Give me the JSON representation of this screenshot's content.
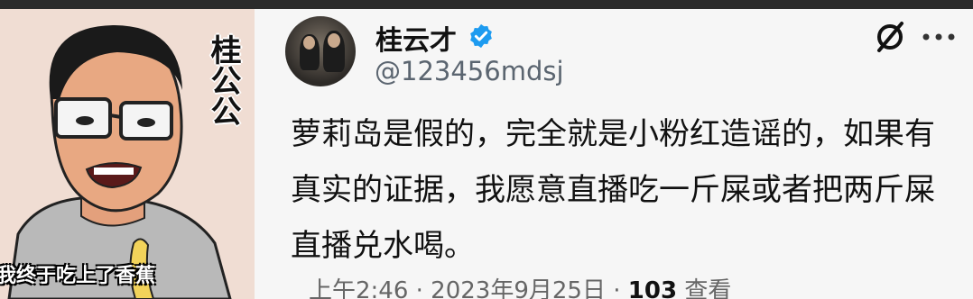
{
  "cartoon": {
    "title": "桂公公",
    "caption": "我终于吃上了香蕉"
  },
  "tweet": {
    "author_name": "桂云才",
    "handle": "@123456mdsj",
    "verified_icon": "verified-badge-icon",
    "text": "萝莉岛是假的，完全就是小粉红造谣的，如果有真实的证据，我愿意直播吃一斤屎或者把两斤屎直播兑水喝。",
    "timestamp": "上午2:46 · 2023年9月25日 · ",
    "views_count": "103",
    "views_label": " 查看"
  },
  "colors": {
    "verified": "#1d9bf0",
    "card_bg": "#f6f6f6",
    "cartoon_bg": "#f0ddd3"
  }
}
